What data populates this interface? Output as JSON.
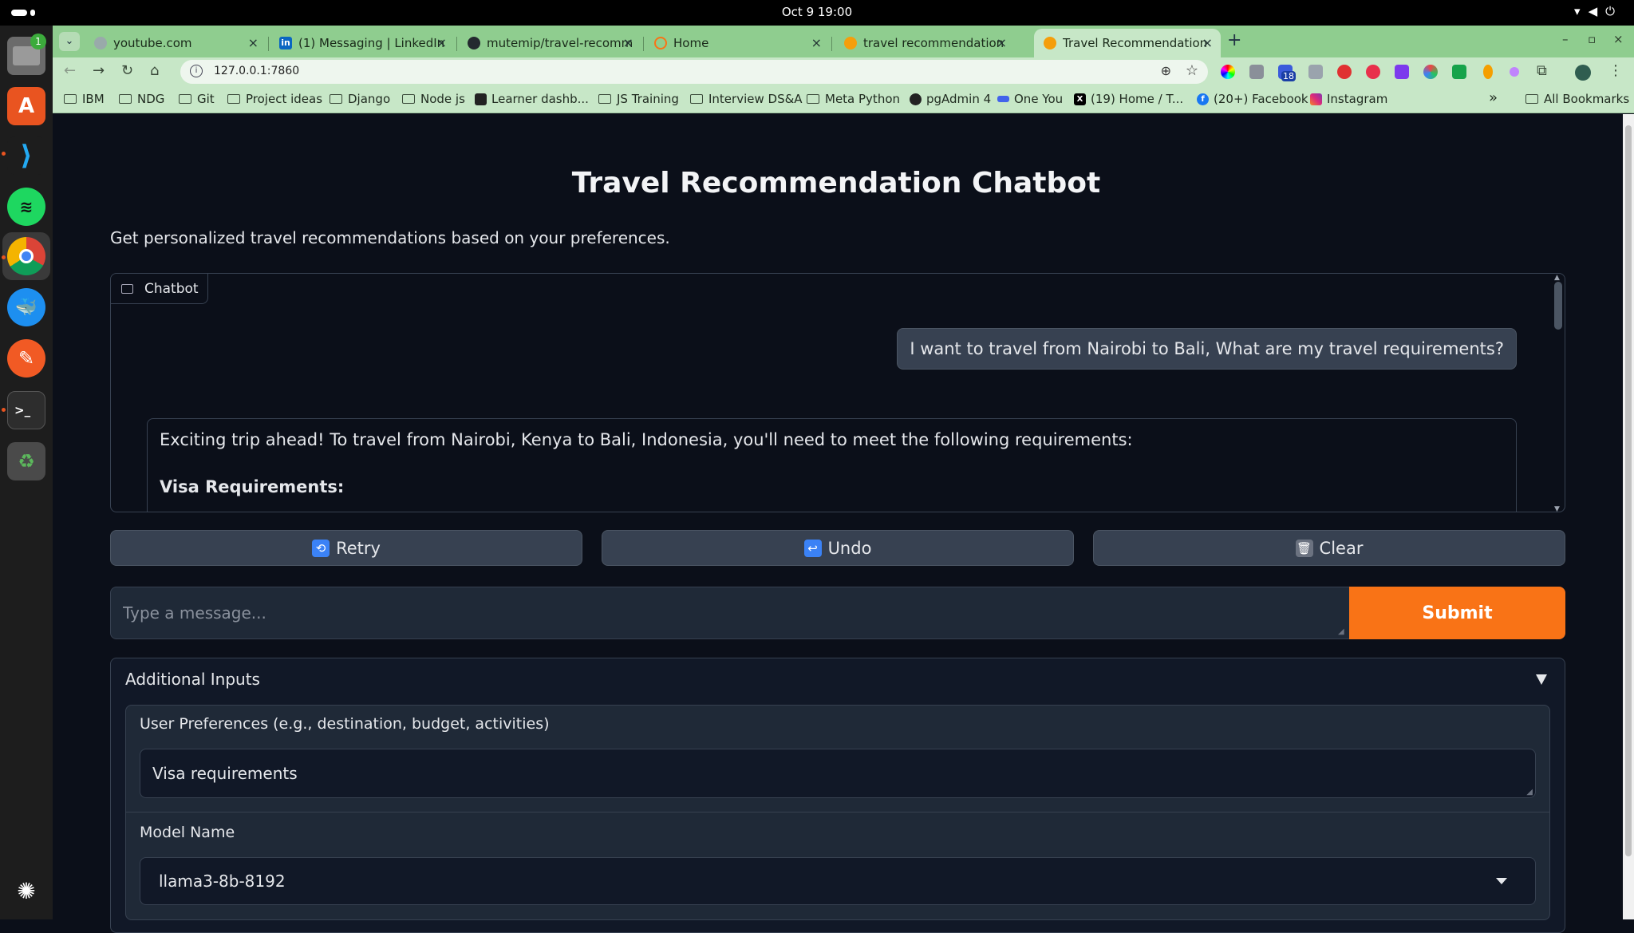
{
  "topbar": {
    "clock": "Oct 9  19:00"
  },
  "dock": {
    "items": [
      "files-icon",
      "ubuntu-software-icon",
      "vscode-icon",
      "spotify-icon",
      "chrome-icon",
      "docker-icon",
      "text-editor-icon",
      "terminal-icon",
      "trash-icon",
      "show-apps-icon"
    ],
    "files_badge": "1"
  },
  "browser": {
    "tabs": [
      {
        "label": "youtube.com"
      },
      {
        "label": "(1) Messaging | LinkedIn"
      },
      {
        "label": "mutemip/travel-recomm"
      },
      {
        "label": "Home"
      },
      {
        "label": "travel recommendation"
      },
      {
        "label": "Travel Recommendation"
      }
    ],
    "url": "127.0.0.1:7860",
    "extension_badge": "18",
    "bookmarks": [
      {
        "label": "IBM"
      },
      {
        "label": "NDG"
      },
      {
        "label": "Git"
      },
      {
        "label": "Project ideas"
      },
      {
        "label": "Django"
      },
      {
        "label": "Node js"
      },
      {
        "label": "Learner dashb..."
      },
      {
        "label": "JS Training"
      },
      {
        "label": "Interview DS&A"
      },
      {
        "label": "Meta Python"
      },
      {
        "label": "pgAdmin 4"
      },
      {
        "label": "One You"
      },
      {
        "label": "(19) Home / T..."
      },
      {
        "label": "(20+) Facebook"
      },
      {
        "label": "Instagram"
      }
    ],
    "overflow": "»",
    "all_bookmarks": "All Bookmarks"
  },
  "app": {
    "title": "Travel Recommendation Chatbot",
    "description": "Get personalized travel recommendations based on your preferences.",
    "chatbot": {
      "label": "Chatbot",
      "user_message": "I want to travel from Nairobi to Bali, What are my travel requirements?",
      "bot_intro": "Exciting trip ahead! To travel from Nairobi, Kenya to Bali, Indonesia, you'll need to meet the following requirements:",
      "bot_heading": "Visa Requirements:"
    },
    "buttons": {
      "retry": "Retry",
      "undo": "Undo",
      "clear": "Clear",
      "submit": "Submit"
    },
    "message_placeholder": "Type a message...",
    "additional_inputs": {
      "title": "Additional Inputs",
      "prefs_label": "User Preferences (e.g., destination, budget, activities)",
      "prefs_value": "Visa requirements",
      "model_label": "Model Name",
      "model_value": "llama3-8b-8192"
    }
  },
  "colors": {
    "page_bg": "#0b0f19",
    "accent": "#f97316",
    "browser_theme": "#c7e7c7"
  }
}
